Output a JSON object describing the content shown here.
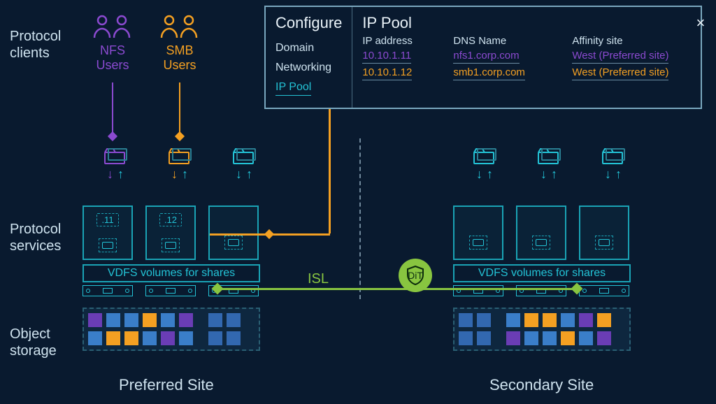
{
  "labels": {
    "protocol_clients": "Protocol\nclients",
    "protocol_services": "Protocol\nservices",
    "object_storage": "Object\nstorage",
    "nfs_users": "NFS\nUsers",
    "smb_users": "SMB\nUsers",
    "ip11": ".11",
    "ip12": ".12",
    "vdfs": "VDFS volumes for shares",
    "isl": "ISL",
    "dit": "DiT",
    "preferred_site": "Preferred Site",
    "secondary_site": "Secondary Site"
  },
  "panel": {
    "configure": "Configure",
    "nav": {
      "domain": "Domain",
      "networking": "Networking",
      "ip_pool": "IP Pool"
    },
    "title": "IP Pool",
    "close": "×",
    "headers": {
      "ip": "IP address",
      "dns": "DNS Name",
      "affinity": "Affinity site"
    },
    "rows": [
      {
        "ip": "10.10.1.11",
        "dns": "nfs1.corp.com",
        "affinity": "West (Preferred site)",
        "cls": "c-pur"
      },
      {
        "ip": "10.10.1.12",
        "dns": "smb1.corp.com",
        "affinity": "West (Preferred site)",
        "cls": "c-orn"
      }
    ]
  }
}
